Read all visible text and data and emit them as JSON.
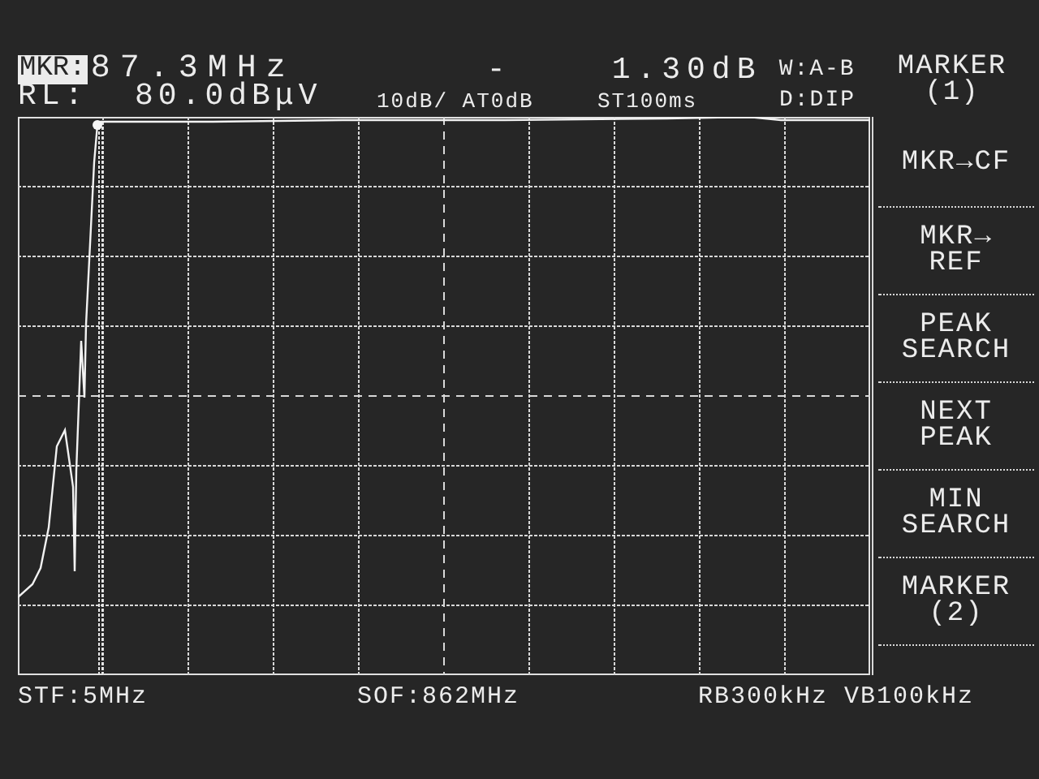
{
  "header": {
    "marker_label": "MKR:",
    "marker_freq": "87.3MHz",
    "delta": "-    1.30dB",
    "window": "W:A-B",
    "ref_level": "RL:  80.0dBμV",
    "scale": "10dB/ AT0dB",
    "sweep": "ST100ms",
    "detector": "D:DIP"
  },
  "menu": {
    "title": "MARKER",
    "subtitle": "(1)"
  },
  "softkeys": [
    {
      "lines": [
        "MKR→CF"
      ]
    },
    {
      "lines": [
        "MKR→",
        "REF"
      ]
    },
    {
      "lines": [
        "PEAK",
        "SEARCH"
      ]
    },
    {
      "lines": [
        "NEXT",
        "PEAK"
      ]
    },
    {
      "lines": [
        "MIN",
        "SEARCH"
      ]
    },
    {
      "lines": [
        "MARKER",
        "(2)"
      ]
    }
  ],
  "footer": {
    "start": "STF:5MHz",
    "offset": "SOF:862MHz",
    "bandwidth": "RB300kHz VB100kHz"
  }
}
